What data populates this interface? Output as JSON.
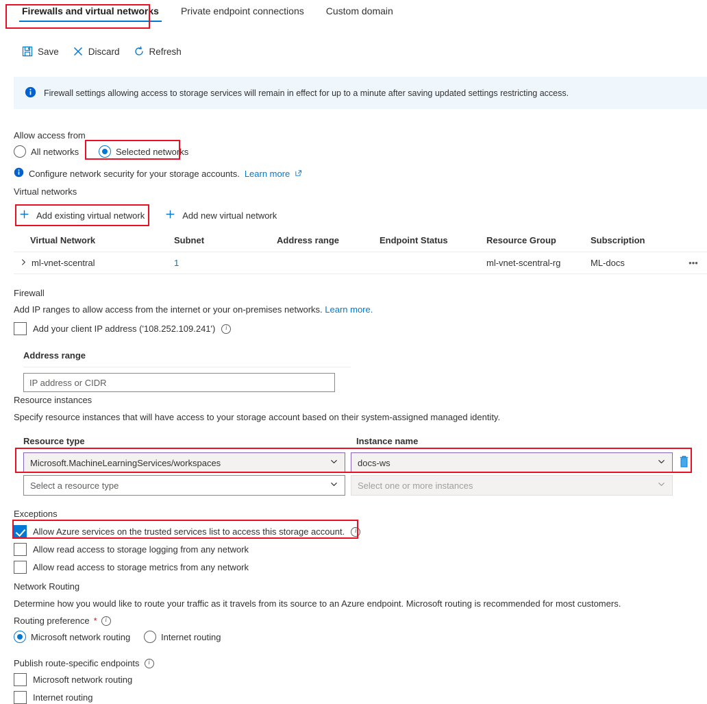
{
  "tabs": [
    {
      "label": "Firewalls and virtual networks",
      "active": true
    },
    {
      "label": "Private endpoint connections",
      "active": false
    },
    {
      "label": "Custom domain",
      "active": false
    }
  ],
  "commands": [
    {
      "label": "Save",
      "icon": "save-icon"
    },
    {
      "label": "Discard",
      "icon": "discard-icon"
    },
    {
      "label": "Refresh",
      "icon": "refresh-icon"
    }
  ],
  "banner": {
    "icon": "info-filled-icon",
    "text": "Firewall settings allowing access to storage services will remain in effect for up to a minute after saving updated settings restricting access."
  },
  "allow_access": {
    "label": "Allow access from",
    "options": [
      {
        "label": "All networks",
        "selected": false
      },
      {
        "label": "Selected networks",
        "selected": true
      }
    ],
    "note": "Configure network security for your storage accounts.",
    "note_link": "Learn more"
  },
  "virtual_networks": {
    "title": "Virtual networks",
    "actions": [
      {
        "label": "Add existing virtual network"
      },
      {
        "label": "Add new virtual network"
      }
    ],
    "columns": [
      "Virtual Network",
      "Subnet",
      "Address range",
      "Endpoint Status",
      "Resource Group",
      "Subscription"
    ],
    "rows": [
      {
        "name": "ml-vnet-scentral",
        "subnet": "1",
        "address_range": "",
        "endpoint_status": "",
        "resource_group": "ml-vnet-scentral-rg",
        "subscription": "ML-docs",
        "menu": "•••"
      }
    ]
  },
  "firewall": {
    "title": "Firewall",
    "description": "Add IP ranges to allow access from the internet or your on-premises networks.",
    "description_link": "Learn more.",
    "client_ip_checkbox": {
      "label": "Add your client IP address ('108.252.109.241')",
      "checked": false
    },
    "address_range_label": "Address range",
    "address_range_placeholder": "IP address or CIDR",
    "address_range_value": ""
  },
  "resource_instances": {
    "title": "Resource instances",
    "description": "Specify resource instances that will have access to your storage account based on their system-assigned managed identity.",
    "columns": {
      "resource_type": "Resource type",
      "instance_name": "Instance name"
    },
    "rows": [
      {
        "resource_type": "Microsoft.MachineLearningServices/workspaces",
        "instance_name": "docs-ws",
        "filled": true,
        "delete_icon": "trash-icon"
      },
      {
        "resource_type": "Select a resource type",
        "instance_name": "Select one or more instances",
        "filled": false
      }
    ]
  },
  "exceptions": {
    "title": "Exceptions",
    "items": [
      {
        "label": "Allow Azure services on the trusted services list to access this storage account.",
        "checked": true,
        "info": true
      },
      {
        "label": "Allow read access to storage logging from any network",
        "checked": false,
        "info": false
      },
      {
        "label": "Allow read access to storage metrics from any network",
        "checked": false,
        "info": false
      }
    ]
  },
  "network_routing": {
    "title": "Network Routing",
    "description": "Determine how you would like to route your traffic as it travels from its source to an Azure endpoint. Microsoft routing is recommended for most customers.",
    "routing_preference_label": "Routing preference",
    "required_marker": "*",
    "options": [
      {
        "label": "Microsoft network routing",
        "selected": true
      },
      {
        "label": "Internet routing",
        "selected": false
      }
    ],
    "publish_label": "Publish route-specific endpoints",
    "publish_options": [
      {
        "label": "Microsoft network routing",
        "checked": false
      },
      {
        "label": "Internet routing",
        "checked": false
      }
    ]
  },
  "colors": {
    "accent": "#0078d4",
    "annotation": "#e81123",
    "banner_bg": "#eff6fc",
    "focus_border": "#8764b8"
  }
}
